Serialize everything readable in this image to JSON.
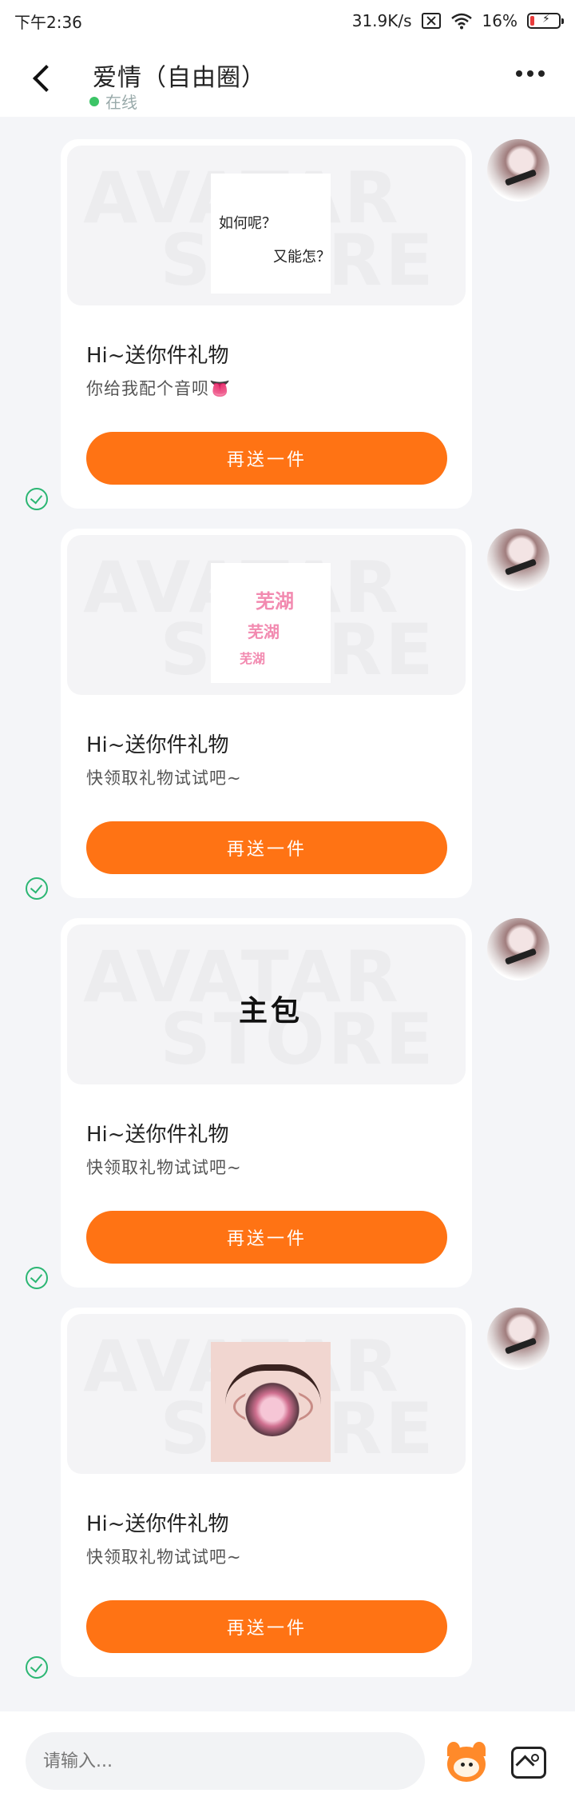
{
  "status_bar": {
    "time": "下午2:36",
    "network_speed": "31.9K/s",
    "battery": "16%",
    "battery_level": 0.16
  },
  "header": {
    "title": "爱情（自由圈）",
    "presence": "在线",
    "back_icon": "chevron-left-icon",
    "more_icon": "more-dots-icon"
  },
  "messages": [
    {
      "preview_watermark": [
        "AVATAR",
        "STORE"
      ],
      "image_text": [
        "如何呢？",
        "又能怎？"
      ],
      "title": "Hi~送你件礼物",
      "subtitle": "你给我配个音呗👅",
      "button": "再送一件"
    },
    {
      "preview_watermark": [
        "AVATAR",
        "STORE"
      ],
      "image_text": [
        "芜湖",
        "芜湖",
        "芜湖"
      ],
      "title": "Hi~送你件礼物",
      "subtitle": "快领取礼物试试吧~",
      "button": "再送一件"
    },
    {
      "preview_watermark": [
        "AVATAR",
        "STORE"
      ],
      "image_text": [
        "主包"
      ],
      "title": "Hi~送你件礼物",
      "subtitle": "快领取礼物试试吧~",
      "button": "再送一件"
    },
    {
      "preview_watermark": [
        "AVATAR",
        "STORE"
      ],
      "image_text": [],
      "title": "Hi~送你件礼物",
      "subtitle": "快领取礼物试试吧~",
      "button": "再送一件"
    }
  ],
  "input_bar": {
    "placeholder": "请输入...",
    "mascot_icon": "mascot-emoji-icon",
    "image_icon": "image-picker-icon"
  },
  "colors": {
    "accent": "#ff7314",
    "online": "#3cc466",
    "read": "#2bb673",
    "background": "#f4f5f8"
  }
}
